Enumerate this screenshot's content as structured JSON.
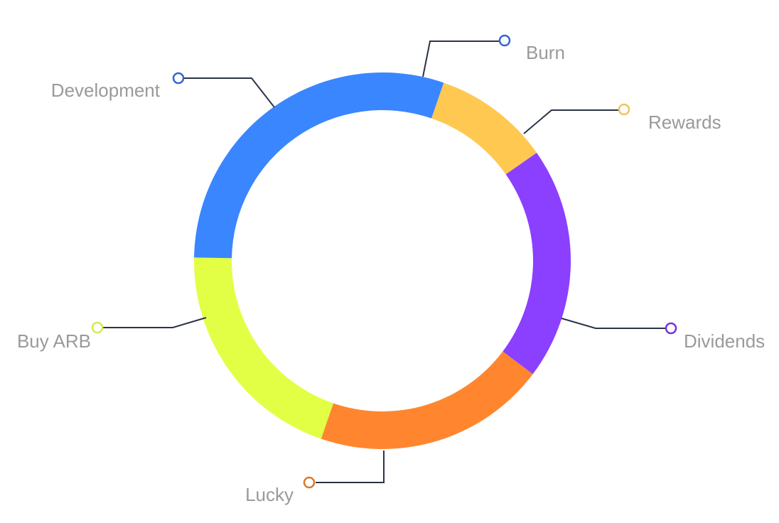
{
  "chart_data": {
    "type": "pie",
    "variant": "donut",
    "title": "",
    "slices": [
      {
        "label": "Burn",
        "value": 10,
        "color": "#FFC850"
      },
      {
        "label": "Dividends",
        "value": 20,
        "color": "#8B3FFF"
      },
      {
        "label": "Lucky",
        "value": 20,
        "color": "#FF862F"
      },
      {
        "label": "Buy ARB",
        "value": 20,
        "color": "#E2FF45"
      },
      {
        "label": "Development",
        "value": 30,
        "color": "#3A86FF"
      }
    ],
    "callouts": [
      {
        "label": "Burn",
        "marker_color": "#3366CC"
      },
      {
        "label": "Rewards",
        "marker_color": "#F2C45A"
      },
      {
        "label": "Dividends",
        "marker_color": "#7A2FE0"
      },
      {
        "label": "Lucky",
        "marker_color": "#D9782E"
      },
      {
        "label": "Buy ARB",
        "marker_color": "#D4EC52"
      },
      {
        "label": "Development",
        "marker_color": "#3366CC"
      }
    ],
    "legend": "callouts"
  }
}
